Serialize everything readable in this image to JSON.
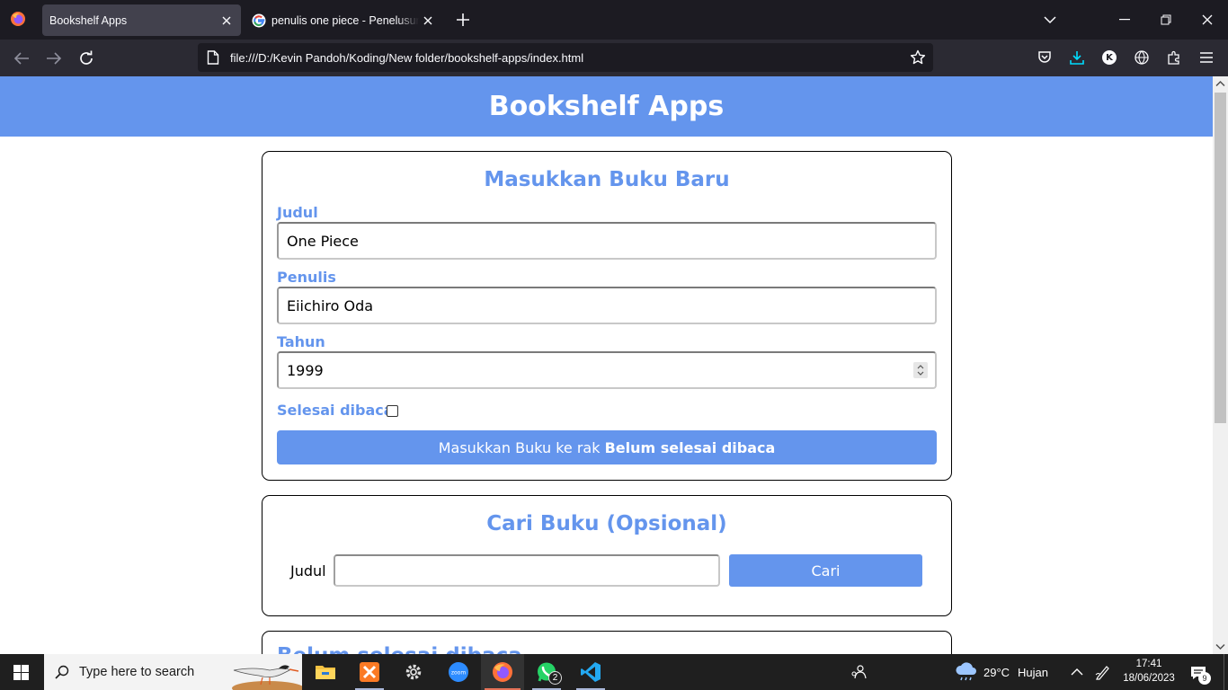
{
  "browser": {
    "tabs": [
      {
        "title": "Bookshelf Apps",
        "active": true
      },
      {
        "title": "penulis one piece - Penelusuran",
        "active": false
      }
    ],
    "url": "file:///D:/Kevin Pandoh/Koding/New folder/bookshelf-apps/index.html",
    "profile_initial": "K"
  },
  "app": {
    "header_title": "Bookshelf Apps",
    "input_section": {
      "title": "Masukkan Buku Baru",
      "title_label": "Judul",
      "title_value": "One Piece",
      "author_label": "Penulis",
      "author_value": "Eiichiro Oda",
      "year_label": "Tahun",
      "year_value": "1999",
      "is_complete_label": "Selesai dibaca",
      "is_complete_checked": false,
      "submit_prefix": "Masukkan Buku ke rak ",
      "submit_shelf": "Belum selesai dibaca"
    },
    "search_section": {
      "title": "Cari Buku (Opsional)",
      "label": "Judul",
      "value": "",
      "button": "Cari"
    },
    "third_section": {
      "title": "Belum selesai dibaca"
    }
  },
  "taskbar": {
    "search_placeholder": "Type here to search",
    "whatsapp_badge": "2",
    "weather_temp": "29°C",
    "weather_desc": "Hujan",
    "time": "17:41",
    "date": "18/06/2023",
    "notification_count": "9"
  },
  "colors": {
    "accent": "#6495ed",
    "tab_active": "#42414d",
    "toolbar": "#2b2a33",
    "taskbar": "#1f1f1f"
  }
}
